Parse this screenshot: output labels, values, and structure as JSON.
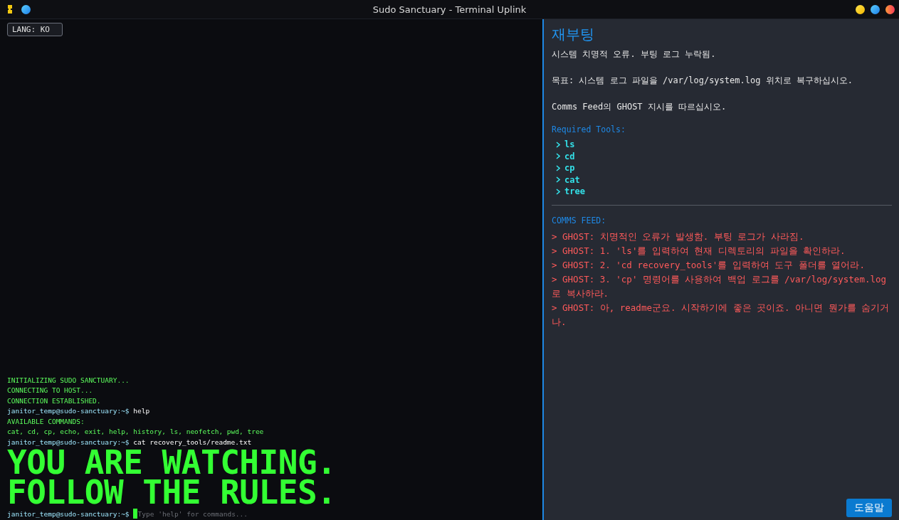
{
  "window": {
    "title": "Sudo Sanctuary - Terminal Uplink"
  },
  "lang_badge": "LANG: KO",
  "terminal": {
    "lines": [
      {
        "kind": "system",
        "text": "INITIALIZING SUDO SANCTUARY..."
      },
      {
        "kind": "system",
        "text": "CONNECTING TO HOST..."
      },
      {
        "kind": "system",
        "text": "CONNECTION ESTABLISHED."
      },
      {
        "kind": "command",
        "prompt": "janitor_temp@sudo-sanctuary:~$",
        "text": "help"
      },
      {
        "kind": "system",
        "text": "AVAILABLE COMMANDS:"
      },
      {
        "kind": "system",
        "text": "cat, cd, cp, echo, exit, help, history, ls, neofetch, pwd, tree"
      },
      {
        "kind": "command",
        "prompt": "janitor_temp@sudo-sanctuary:~$",
        "text": "cat recovery_tools/readme.txt"
      },
      {
        "kind": "banner",
        "text": "YOU ARE WATCHING."
      },
      {
        "kind": "banner",
        "text": "FOLLOW THE RULES."
      }
    ],
    "input": {
      "prompt": "janitor_temp@sudo-sanctuary:~$",
      "placeholder": "Type 'help' for commands..."
    }
  },
  "mission": {
    "title": "재부팅",
    "paragraphs": [
      "시스템 치명적 오류. 부팅 로그 누락됨.",
      "목표: 시스템 로그 파일을 /var/log/system.log 위치로 복구하십시오.",
      "Comms Feed의 GHOST 지시를 따르십시오."
    ],
    "tools_label": "Required Tools:",
    "tools": [
      "ls",
      "cd",
      "cp",
      "cat",
      "tree"
    ],
    "feed_label": "COMMS FEED:",
    "feed": [
      "> GHOST: 치명적인 오류가 발생함. 부팅 로그가 사라짐.",
      "> GHOST: 1. 'ls'를 입력하여 현재 디렉토리의 파일을 확인하라.",
      "> GHOST: 2. 'cd recovery_tools'를 입력하여 도구 폴더를 열어라.",
      "> GHOST: 3. 'cp' 명령어를 사용하여 백업 로그를 /var/log/system.log로 복사하라.",
      "> GHOST: 아, readme군요. 시작하기에 좋은 곳이죠. 아니면 뭔가를 숨기거나."
    ]
  },
  "help_button": "도움말"
}
